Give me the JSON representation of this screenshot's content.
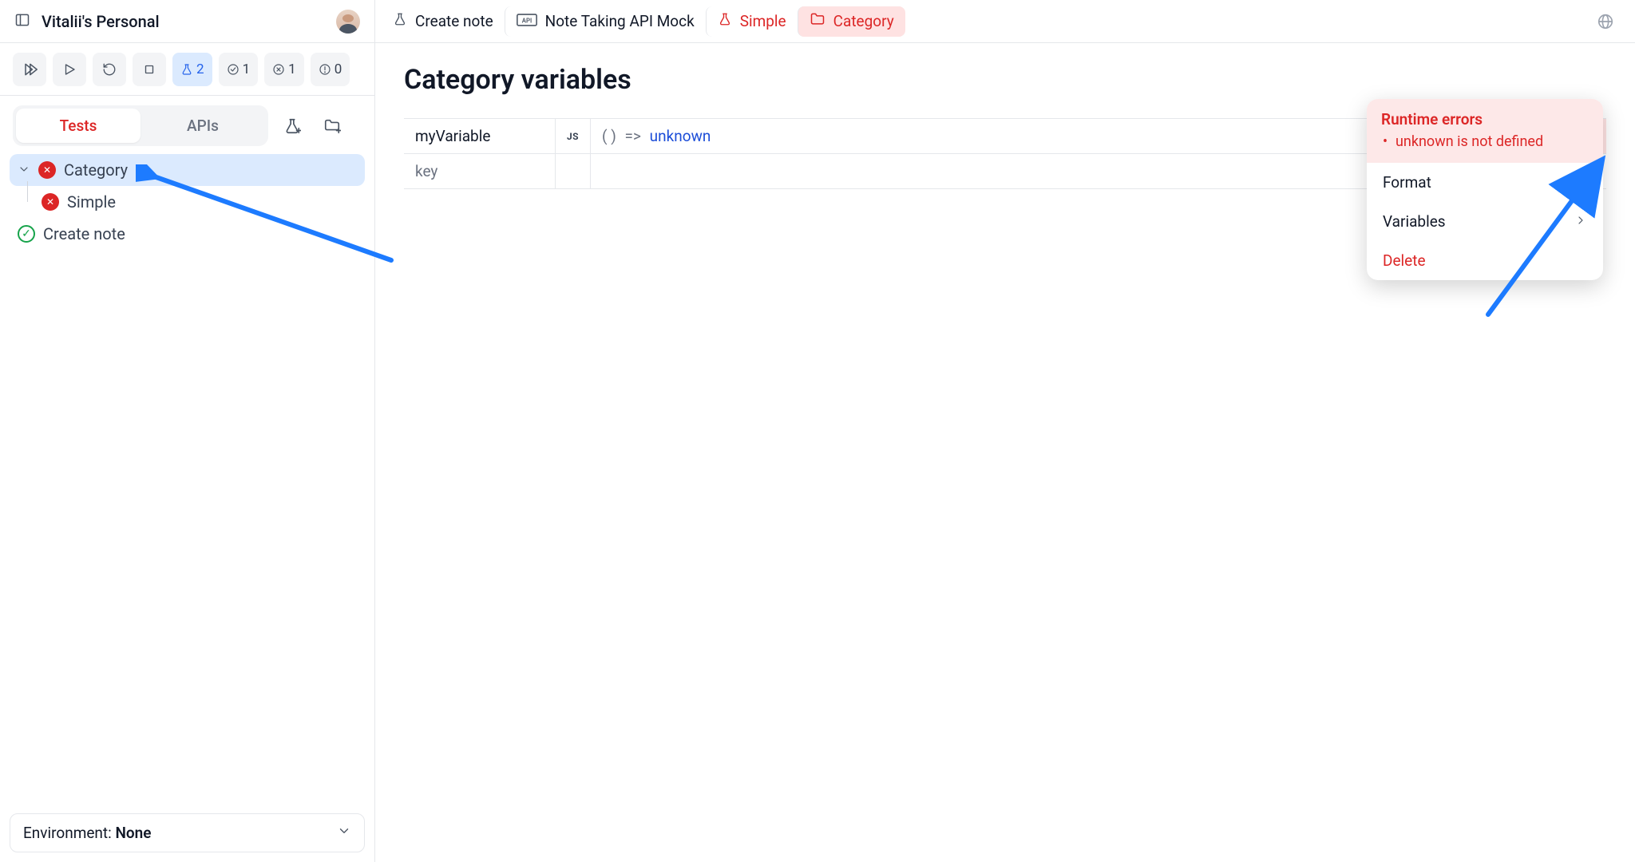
{
  "workspace": {
    "name": "Vitalii's Personal"
  },
  "breadcrumbs": [
    {
      "icon": "flask",
      "label": "Create note",
      "active": false
    },
    {
      "icon": "api",
      "label": "Note Taking API Mock",
      "active": false
    },
    {
      "icon": "flask",
      "label": "Simple",
      "active": false,
      "red": true
    },
    {
      "icon": "folder",
      "label": "Category",
      "active": true
    }
  ],
  "toolbar": {
    "counts": {
      "flask": "2",
      "pass": "1",
      "fail": "1",
      "warn": "0"
    }
  },
  "tabs": {
    "tests": "Tests",
    "apis": "APIs",
    "active": "tests"
  },
  "tree": [
    {
      "type": "folder",
      "label": "Category",
      "status": "fail",
      "selected": true,
      "expandable": true
    },
    {
      "type": "test",
      "label": "Simple",
      "status": "fail",
      "child": true
    },
    {
      "type": "test",
      "label": "Create note",
      "status": "pass"
    }
  ],
  "env": {
    "prefix": "Environment: ",
    "value": "None"
  },
  "page": {
    "title": "Category variables"
  },
  "variables": [
    {
      "name": "myVariable",
      "lang": "JS",
      "expr_prefix": "( )  =>  ",
      "expr_ident": "unknown",
      "has_menu": true
    },
    {
      "name": "key",
      "placeholder": true
    }
  ],
  "popover": {
    "errors_header": "Runtime errors",
    "errors": [
      "unknown is not defined"
    ],
    "actions": [
      {
        "label": "Format",
        "danger": false
      },
      {
        "label": "Variables",
        "danger": false,
        "chevron": true
      },
      {
        "label": "Delete",
        "danger": true
      }
    ]
  },
  "colors": {
    "red": "#dc2626",
    "blue": "#2563eb"
  }
}
